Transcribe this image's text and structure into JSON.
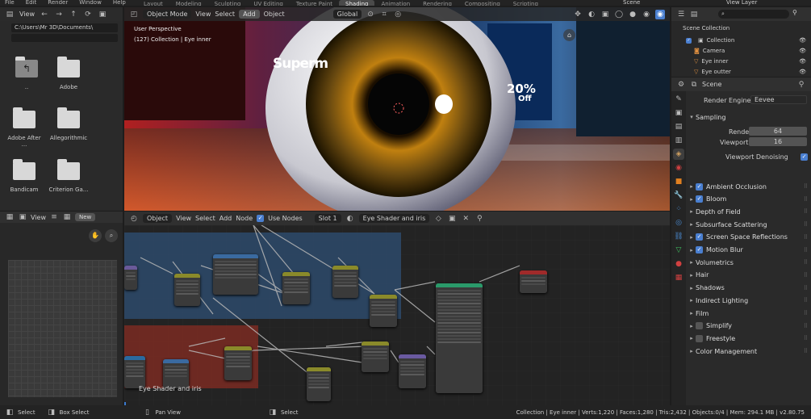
{
  "menu": {
    "items": [
      "File",
      "Edit",
      "Render",
      "Window",
      "Help"
    ]
  },
  "workspaces": [
    "Layout",
    "Modeling",
    "Sculpting",
    "UV Editing",
    "Texture Paint",
    "Shading",
    "Animation",
    "Rendering",
    "Compositing",
    "Scripting"
  ],
  "active_workspace": "Shading",
  "top_right": {
    "scene": "Scene",
    "view_layer": "View Layer"
  },
  "file_browser": {
    "view_label": "View",
    "path": "C:\\Users\\Mr 3D\\Documents\\",
    "items": [
      "..",
      " Adobe",
      "Adobe After ...",
      "Allegorithmic",
      "Bandicam",
      "Criterion Ga..."
    ]
  },
  "viewport": {
    "mode": "Object Mode",
    "view": "View",
    "select": "Select",
    "add": "Add",
    "object": "Object",
    "orientation": "Global",
    "perspective": "User Perspective",
    "collection": "(127) Collection | Eye inner",
    "signs": {
      "sign1": "Superm",
      "sign2": "20%",
      "sign3": "Off"
    }
  },
  "outliner": {
    "title": "Scene Collection",
    "items": [
      {
        "label": "Collection",
        "icon": "collection-icon"
      },
      {
        "label": "Camera",
        "icon": "camera-icon"
      },
      {
        "label": "Eye inner",
        "icon": "mesh-icon"
      },
      {
        "label": "Eye outter",
        "icon": "mesh-icon"
      }
    ]
  },
  "properties": {
    "scene_label": "Scene",
    "render_engine_label": "Render Engine",
    "render_engine": "Eevee",
    "sampling": "Sampling",
    "render_label": "Render",
    "render_value": "64",
    "viewport_label": "Viewport",
    "viewport_value": "16",
    "denoise_label": "Viewport Denoising",
    "panels": [
      {
        "label": "Ambient Occlusion",
        "check": true
      },
      {
        "label": "Bloom",
        "check": true
      },
      {
        "label": "Depth of Field",
        "check": null
      },
      {
        "label": "Subsurface Scattering",
        "check": null
      },
      {
        "label": "Screen Space Reflections",
        "check": true
      },
      {
        "label": "Motion Blur",
        "check": true
      },
      {
        "label": "Volumetrics",
        "check": null
      },
      {
        "label": "Hair",
        "check": null
      },
      {
        "label": "Shadows",
        "check": null
      },
      {
        "label": "Indirect Lighting",
        "check": null
      },
      {
        "label": "Film",
        "check": null
      },
      {
        "label": "Simplify",
        "check": false
      },
      {
        "label": "Freestyle",
        "check": false
      },
      {
        "label": "Color Management",
        "check": null
      }
    ]
  },
  "image_editor": {
    "view": "View",
    "new": "New"
  },
  "node_editor": {
    "object": "Object",
    "view": "View",
    "select": "Select",
    "add": "Add",
    "node": "Node",
    "use_nodes": "Use Nodes",
    "slot": "Slot 1",
    "material": "Eye Shader and iris",
    "frame_label": "Eye Shader and iris"
  },
  "status": {
    "select": "Select",
    "box_select": "Box Select",
    "pan_view": "Pan View",
    "select2": "Select",
    "stats": "Collection | Eye inner | Verts:1,220 | Faces:1,280 | Tris:2,432 | Objects:0/4 | Mem: 294.1 MB | v2.80.75"
  },
  "colors": {
    "accent": "#4a7fd0",
    "header": "#303030",
    "frame_blue": "#2d4a6b",
    "frame_red": "#7a2a22"
  }
}
